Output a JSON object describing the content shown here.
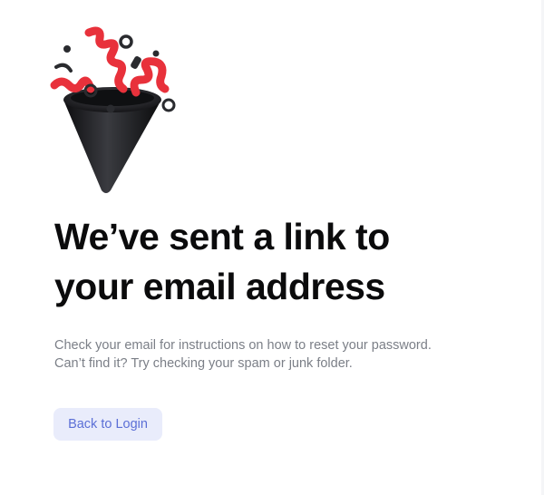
{
  "confirmation": {
    "headline_line1": "We’ve sent a link to",
    "headline_line2": "your email address",
    "body_line1": "Check your email for instructions on how to reset your password.",
    "body_line2": "Can’t find it? Try checking your spam or junk folder."
  },
  "actions": {
    "back_label": "Back to Login"
  },
  "illustration": {
    "icon": "party-popper-icon"
  },
  "colors": {
    "headline": "#0b0b0c",
    "body": "#7b7f87",
    "button_bg": "#e9ecfb",
    "button_text": "#5b6fd6",
    "confetti_red": "#e8313b",
    "cone": "#1c1d20"
  }
}
